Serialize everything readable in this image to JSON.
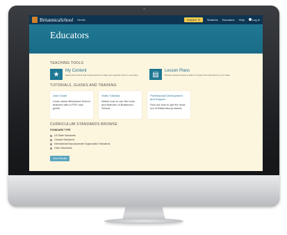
{
  "brand": {
    "name": "Britannica",
    "script_name": "School",
    "sub": "Middle"
  },
  "topnav": {
    "search_label": "Explore",
    "links": [
      "Students",
      "Educators",
      "Help",
      "Log In"
    ]
  },
  "hero": {
    "title": "Educators"
  },
  "teaching_tools": {
    "heading": "TEACHING TOOLS",
    "items": [
      {
        "title": "My Content",
        "description": "Easily find content and curate lessons to share and organize them in one place.",
        "icon": "star-icon"
      },
      {
        "title": "Lesson Plans",
        "description": "Browse and get access to plans to support the instruction in your class.",
        "icon": "lesson-plan-icon"
      }
    ]
  },
  "tutorials": {
    "heading": "TUTORIALS, GUIDES AND TRAINING",
    "cards": [
      {
        "title": "User Guide",
        "description": "Learn about Britannica School features with a PDF user guide."
      },
      {
        "title": "Video Tutorials",
        "description": "Watch how to use the tools and features of Britannica School."
      },
      {
        "title": "Professional Development and Support",
        "description": "Find out how to get the most out of Britannica products."
      }
    ]
  },
  "standards": {
    "heading": "CURRICULUM STANDARDS BROWSE",
    "subheading": "STANDARD TYPE",
    "options": [
      "US State Standards",
      "Canada Standards",
      "International Baccalaureate Organization Standards",
      "Other Standards"
    ],
    "button_label": "View Results"
  },
  "colors": {
    "topbar": "#0d3552",
    "hero": "#1f7894",
    "page_bg": "#fdf6df",
    "accent_button": "#f2c94c"
  }
}
